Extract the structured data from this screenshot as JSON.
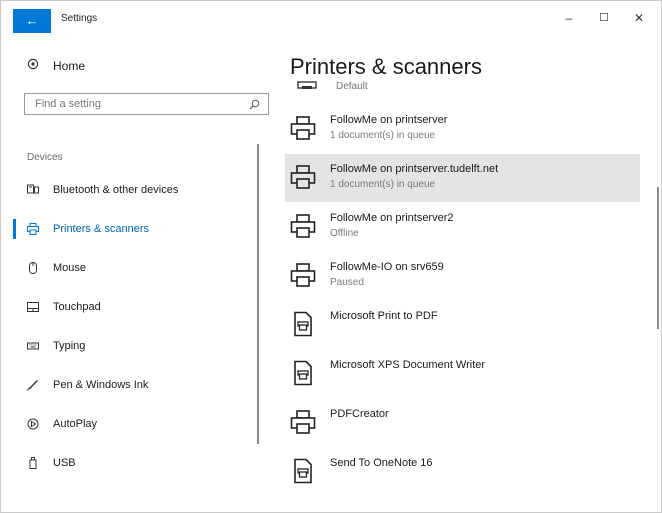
{
  "window": {
    "title": "Settings",
    "back_glyph": "←",
    "minimize": "–",
    "maximize": "☐",
    "close": "✕"
  },
  "sidebar": {
    "home_label": "Home",
    "search_placeholder": "Find a setting",
    "section_label": "Devices",
    "items": [
      {
        "label": "Bluetooth & other devices",
        "icon": "bluetooth-devices-icon"
      },
      {
        "label": "Printers & scanners",
        "icon": "printer-icon",
        "selected": true
      },
      {
        "label": "Mouse",
        "icon": "mouse-icon"
      },
      {
        "label": "Touchpad",
        "icon": "touchpad-icon"
      },
      {
        "label": "Typing",
        "icon": "keyboard-icon"
      },
      {
        "label": "Pen & Windows Ink",
        "icon": "pen-icon"
      },
      {
        "label": "AutoPlay",
        "icon": "autoplay-icon"
      },
      {
        "label": "USB",
        "icon": "usb-icon"
      }
    ]
  },
  "main": {
    "title": "Printers & scanners",
    "default_label": "Default",
    "devices": [
      {
        "name": "FollowMe on printserver",
        "status": "1 document(s) in queue",
        "icon": "printer-icon"
      },
      {
        "name": "FollowMe on printserver.tudelft.net",
        "status": "1 document(s) in queue",
        "icon": "printer-icon",
        "selected": true
      },
      {
        "name": "FollowMe on printserver2",
        "status": "Offline",
        "icon": "printer-icon"
      },
      {
        "name": "FollowMe-IO on srv659",
        "status": "Paused",
        "icon": "printer-icon"
      },
      {
        "name": "Microsoft Print to PDF",
        "status": "",
        "icon": "document-printer-icon"
      },
      {
        "name": "Microsoft XPS Document Writer",
        "status": "",
        "icon": "document-printer-icon"
      },
      {
        "name": "PDFCreator",
        "status": "",
        "icon": "printer-icon"
      },
      {
        "name": "Send To OneNote 16",
        "status": "",
        "icon": "document-printer-icon"
      }
    ]
  },
  "colors": {
    "accent": "#0078d7",
    "selected_row": "#e4e4e4"
  }
}
